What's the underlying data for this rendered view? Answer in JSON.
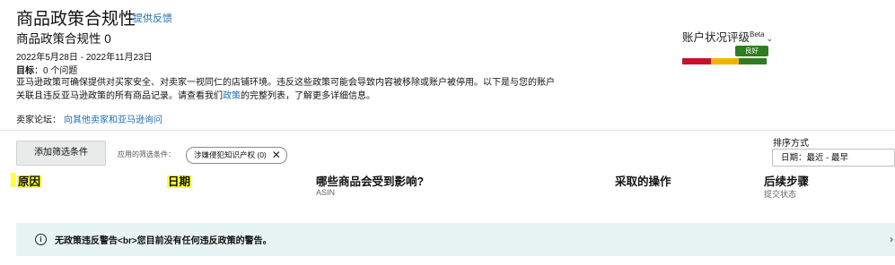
{
  "header": {
    "title": "商品政策合规性",
    "feedback_link": "提供反馈",
    "subtitle": "商品政策合规性 0",
    "date_range": "2022年5月28日 - 2022年11月23日",
    "target_label": "目标",
    "target_value": "：0 个问题",
    "description_part1": "亚马逊政策可确保提供对买家安全、对卖家一视同仁的店铺环境。违反这些政策可能会导致内容被移除或账户被停用。以下是与您的账户",
    "description_part2_prefix": "关联且违反亚马逊政策的所有商品记录。请查看我们",
    "description_link": "政策",
    "description_part2_suffix": "的完整列表，了解更多详细信息。",
    "forum_label": "卖家论坛：",
    "forum_link": "向其他卖家和亚马逊询问"
  },
  "account_health": {
    "label": "账户状况评级",
    "beta": "Beta",
    "badge": "良好",
    "segments": [
      "#c8102e",
      "#f0b400",
      "#2e7d1f"
    ]
  },
  "filters": {
    "add_button": "添加筛选条件",
    "applied_label": "应用的筛选条件：",
    "chip_label": "涉嫌侵犯知识产权 (0)"
  },
  "sort": {
    "label": "排序方式",
    "selected": "日期：最近 - 最早"
  },
  "table": {
    "columns": [
      {
        "title": "原因",
        "sub": ""
      },
      {
        "title": "日期",
        "sub": ""
      },
      {
        "title": "哪些商品会受到影响?",
        "sub": "ASIN"
      },
      {
        "title": "采取的操作",
        "sub": ""
      },
      {
        "title": "后续步骤",
        "sub": "提交状态"
      }
    ]
  },
  "alert": {
    "icon": "info-icon",
    "message": "无政策违反警告<br>您目前没有任何违反政策的警告。",
    "close_icon": "chevron-right-icon"
  }
}
